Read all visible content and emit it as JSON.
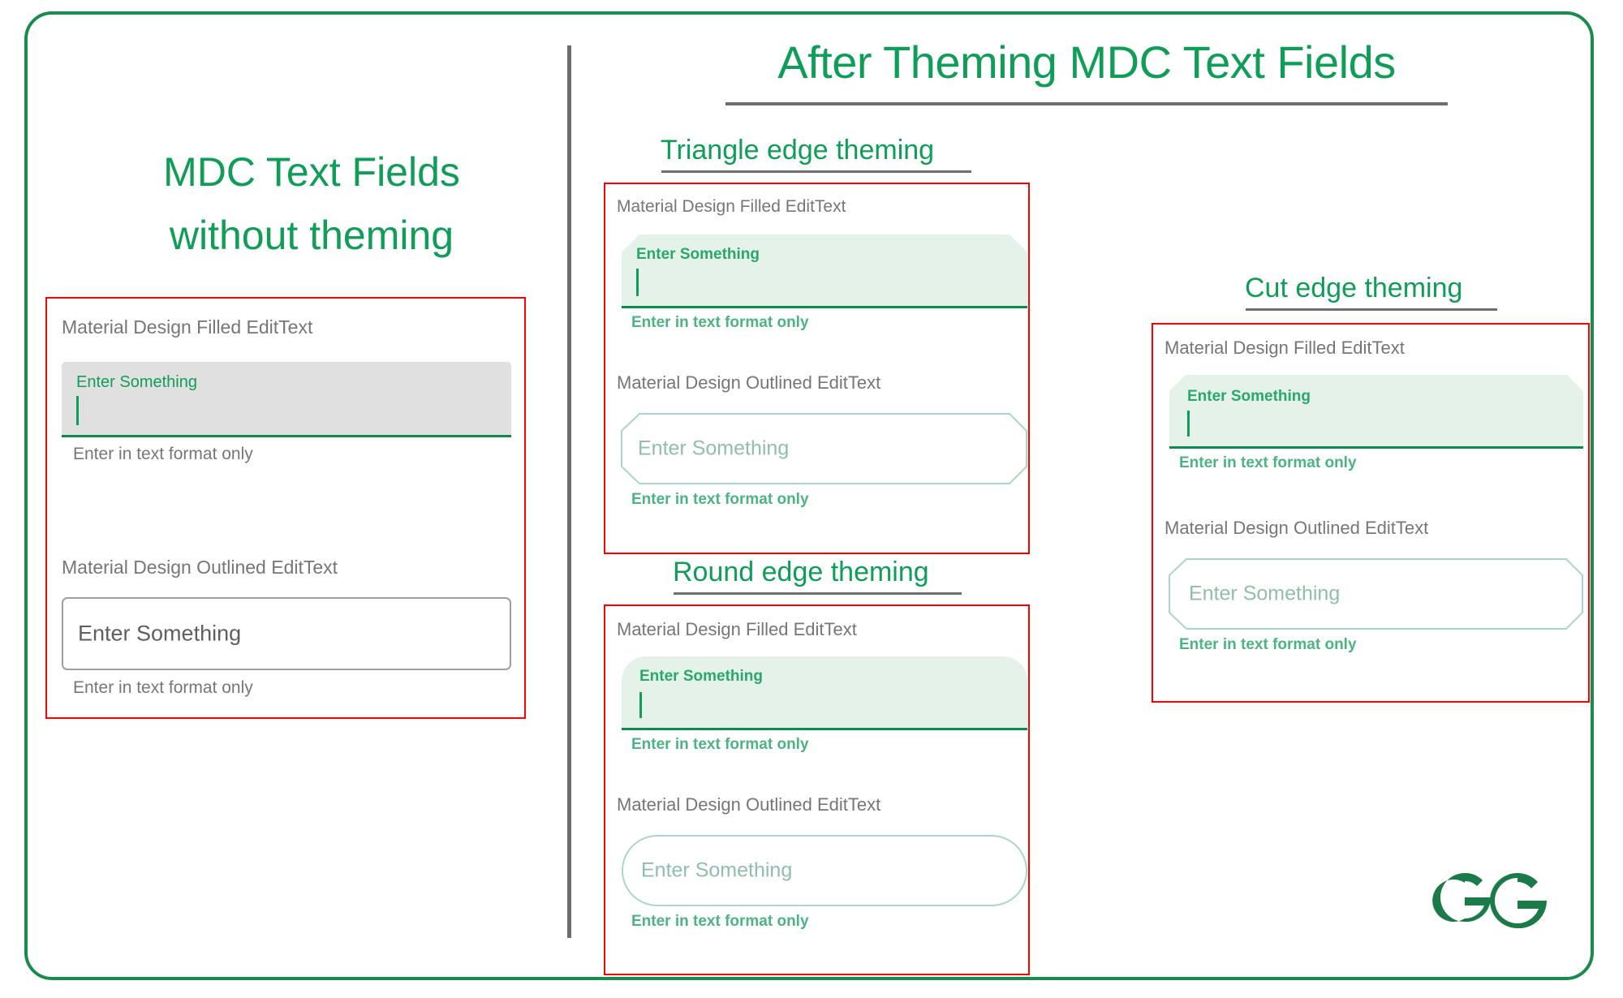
{
  "slide": {
    "main_title": "After Theming MDC Text Fields",
    "left_title_line1": "MDC Text Fields",
    "left_title_line2": "without theming",
    "accent_green": "#0f9d58",
    "border_green": "#1a8a4d",
    "card_border_red": "#ff0000",
    "divider_gray": "#6e6e6e",
    "unthemed_fill": "#e0e0e0",
    "themed_fill": "#e4f2ea",
    "themed_helper_green": "#4cb482",
    "label_gray": "#767676",
    "logo": "geeksforgeeks-logo"
  },
  "sections": {
    "triangle": "Triangle edge theming",
    "round": "Round edge theming",
    "cut": "Cut edge theming"
  },
  "cards": {
    "unthemed": {
      "filled_label": "Material Design Filled EditText",
      "filled_float": "Enter Something",
      "filled_helper": "Enter in text format only",
      "outlined_label": "Material Design Outlined EditText",
      "outlined_placeholder": "Enter Something",
      "outlined_helper": "Enter in text format only"
    },
    "triangle": {
      "filled_label": "Material Design Filled EditText",
      "filled_float": "Enter Something",
      "filled_helper": "Enter in text format only",
      "outlined_label": "Material Design Outlined EditText",
      "outlined_placeholder": "Enter Something",
      "outlined_helper": "Enter in text format only"
    },
    "round": {
      "filled_label": "Material Design Filled EditText",
      "filled_float": "Enter Something",
      "filled_helper": "Enter in text format only",
      "outlined_label": "Material Design Outlined EditText",
      "outlined_placeholder": "Enter Something",
      "outlined_helper": "Enter in text format only"
    },
    "cut": {
      "filled_label": "Material Design Filled EditText",
      "filled_float": "Enter Something",
      "filled_helper": "Enter in text format only",
      "outlined_label": "Material Design Outlined EditText",
      "outlined_placeholder": "Enter Something",
      "outlined_helper": "Enter in text format only"
    }
  }
}
